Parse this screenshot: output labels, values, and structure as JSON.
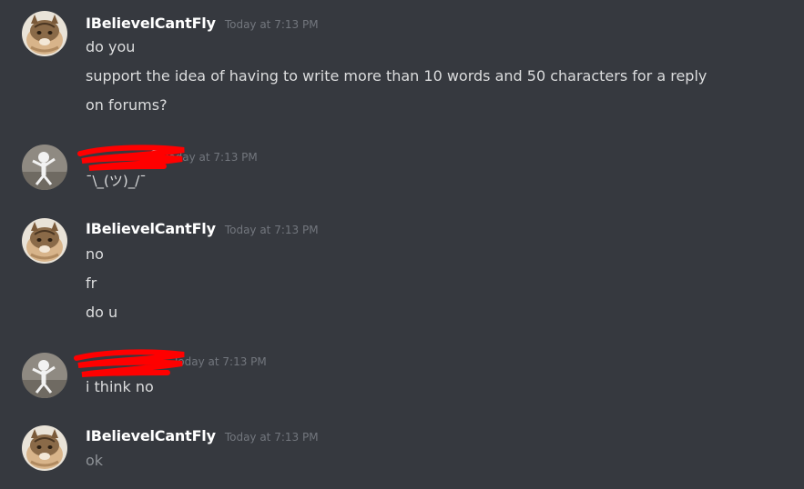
{
  "messages": [
    {
      "author": "IBelievelCantFly",
      "timestamp": "Today at 7:13 PM",
      "avatar_icon": "cat-avatar-icon",
      "lines": [
        "do you",
        "support the idea of having to write more than 10 words and 50 characters for a reply",
        "on forums?"
      ]
    },
    {
      "author": "6",
      "timestamp": "Today at 7:13 PM",
      "avatar_icon": "shrug-figure-avatar-icon",
      "lines": [
        "¯\\_(ツ)_/¯"
      ]
    },
    {
      "author": "IBelievelCantFly",
      "timestamp": "Today at 7:13 PM",
      "avatar_icon": "cat-avatar-icon",
      "lines": [
        "no",
        "fr",
        "do u"
      ]
    },
    {
      "author": "",
      "timestamp": "Today at 7:13 PM",
      "avatar_icon": "shrug-figure-avatar-icon",
      "lines": [
        "i think no"
      ]
    },
    {
      "author": "IBelievelCantFly",
      "timestamp": "Today at 7:13 PM",
      "avatar_icon": "cat-avatar-icon",
      "lines": [
        "ok"
      ]
    }
  ],
  "colors": {
    "background": "#36393f",
    "username": "#ffffff",
    "text": "#dcddde",
    "timestamp": "#72767d",
    "redaction": "#ff0000"
  }
}
